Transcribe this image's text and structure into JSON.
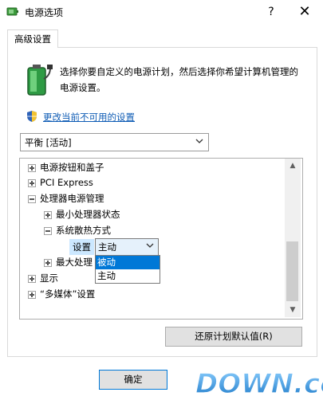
{
  "window": {
    "title": "电源选项",
    "help_glyph": "?",
    "close_glyph": "✕"
  },
  "tab": {
    "label": "高级设置"
  },
  "description": "选择你要自定义的电源计划，然后选择你希望计算机管理的电源设置。",
  "link": {
    "label": "更改当前不可用的设置"
  },
  "plan_select": {
    "value": "平衡 [活动]"
  },
  "tree": {
    "items": [
      {
        "label": "电源按钮和盖子"
      },
      {
        "label": "PCI Express"
      },
      {
        "label": "处理器电源管理"
      },
      {
        "label": "最小处理器状态"
      },
      {
        "label": "系统散热方式"
      },
      {
        "label": "最大处理"
      },
      {
        "label": "显示"
      },
      {
        "label": "“多媒体”设置"
      }
    ],
    "setting_label": "设置",
    "combo_value": "主动",
    "dropdown_options": [
      "被动",
      "主动"
    ]
  },
  "buttons": {
    "restore": "还原计划默认值(R)",
    "ok": "确定"
  },
  "watermark": {
    "text": "DOWN.cc"
  },
  "colors": {
    "link": "#0f5cb5",
    "selection": "#0078d7",
    "highlight": "#cce8ff"
  }
}
